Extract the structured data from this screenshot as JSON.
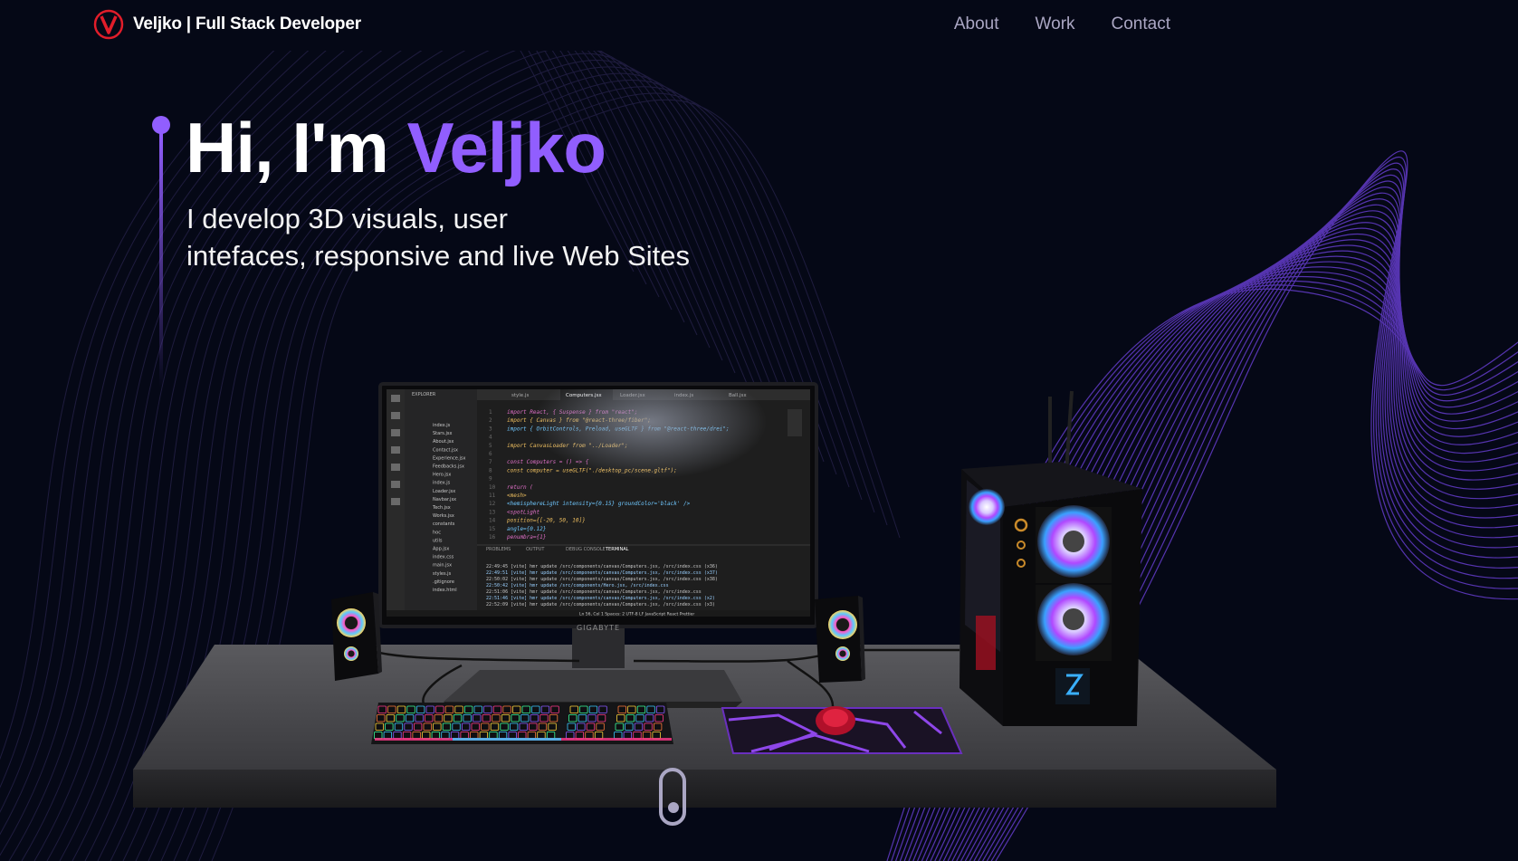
{
  "brand": {
    "name": "Veljko | Full Stack Developer",
    "logo_letter": "V"
  },
  "nav": {
    "items": [
      "About",
      "Work",
      "Contact"
    ]
  },
  "hero": {
    "greeting": "Hi, I'm ",
    "name": "Veljko",
    "subtitle_line1": "I develop 3D visuals, user",
    "subtitle_line2": "intefaces, responsive and live Web Sites"
  },
  "monitor": {
    "brand_label": "GIGABYTE",
    "editor_tabs": [
      "style.js",
      "Computers.jsx",
      "Loader.jsx",
      "index.js",
      "Ball.jsx"
    ],
    "explorer_label": "EXPLORER",
    "file_list": [
      "index.js",
      "Stars.jsx",
      "About.jsx",
      "Contact.jsx",
      "Experience.jsx",
      "Feedbacks.jsx",
      "Hero.jsx",
      "index.js",
      "Loader.jsx",
      "Navbar.jsx",
      "Tech.jsx",
      "Works.jsx",
      "constants",
      "hoc",
      "utils",
      "App.jsx",
      "index.css",
      "main.jsx",
      "styles.js",
      ".gitignore",
      "index.html"
    ],
    "code_lines": [
      "import React, { Suspense } from \"react\";",
      "import { Canvas } from \"@react-three/fiber\";",
      "import { OrbitControls, Preload, useGLTF } from \"@react-three/drei\";",
      "",
      "import CanvasLoader from \"../Loader\";",
      "",
      "const Computers = () => {",
      "  const computer = useGLTF(\"./desktop_pc/scene.gltf\");",
      "",
      "  return (",
      "    <mesh>",
      "      <hemisphereLight intensity={0.15} groundColor='black' />",
      "      <spotLight",
      "        position={[-20, 50, 10]}",
      "        angle={0.12}",
      "        penumbra={1}"
    ],
    "panel_tabs": [
      "PROBLEMS",
      "OUTPUT",
      "DEBUG CONSOLE",
      "TERMINAL"
    ],
    "terminal_lines": [
      "22:49:45 [vite] hmr update /src/components/canvas/Computers.jsx, /src/index.css (x36)",
      "22:49:51 [vite] hmr update /src/components/canvas/Computers.jsx, /src/index.css (x37)",
      "22:50:02 [vite] hmr update /src/components/canvas/Computers.jsx, /src/index.css (x38)",
      "22:50:42 [vite] hmr update /src/components/Hero.jsx, /src/index.css",
      "22:51:06 [vite] hmr update /src/components/canvas/Computers.jsx, /src/index.css",
      "22:51:46 [vite] hmr update /src/components/canvas/Computers.jsx, /src/index.css (x2)",
      "22:52:09 [vite] hmr update /src/components/canvas/Computers.jsx, /src/index.css (x3)"
    ],
    "status_bar": "Ln 56, Col 1   Spaces: 2   UTF-8   LF   JavaScript React   Prettier"
  },
  "colors": {
    "background": "#050816",
    "accent": "#915eff",
    "nav_text": "#aaa6c3",
    "logo_red": "#e11d2a"
  }
}
